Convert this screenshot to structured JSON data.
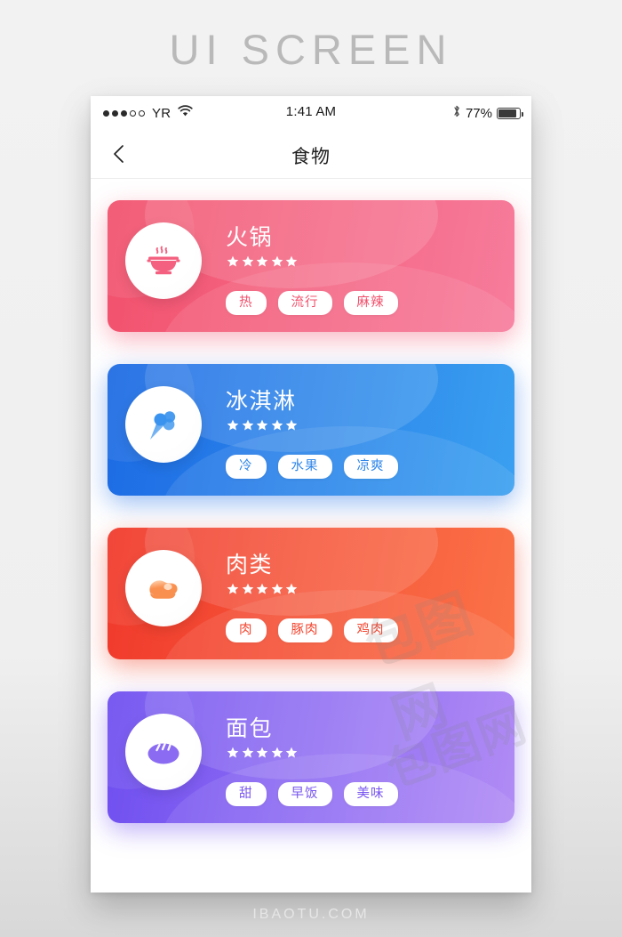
{
  "page": {
    "title": "UI SCREEN",
    "footer": "IBAOTU.COM",
    "watermark": "包图网"
  },
  "statusbar": {
    "carrier": "YR",
    "signal_filled": 3,
    "signal_empty": 2,
    "wifi_icon": "wifi-icon",
    "time": "1:41 AM",
    "bluetooth_icon": "bluetooth-icon",
    "battery_percent": "77%",
    "battery_level": 77
  },
  "navbar": {
    "back_icon": "chevron-left-icon",
    "title": "食物"
  },
  "cards": [
    {
      "id": "hotpot",
      "title": "火锅",
      "icon": "hotpot-icon",
      "rating": 5,
      "tags": [
        "热",
        "流行",
        "麻辣"
      ],
      "gradient_from": "#f2516c",
      "gradient_to": "#f77c9c",
      "accent": "#f2516c",
      "icon_color": "#f4607f",
      "tag_text_color": "#f2516c",
      "shadow_color": "rgba(242,93,120,0.45)"
    },
    {
      "id": "ice-cream",
      "title": "冰淇淋",
      "icon": "ice-cream-icon",
      "rating": 5,
      "tags": [
        "冷",
        "水果",
        "凉爽"
      ],
      "gradient_from": "#1c6ae4",
      "gradient_to": "#3ba0f0",
      "accent": "#1c6ae4",
      "icon_color": "#3a93ee",
      "tag_text_color": "#2f86ea",
      "shadow_color": "rgba(40,115,230,0.45)"
    },
    {
      "id": "meat",
      "title": "肉类",
      "icon": "meat-icon",
      "rating": 5,
      "tags": [
        "肉",
        "豚肉",
        "鸡肉"
      ],
      "gradient_from": "#f0392b",
      "gradient_to": "#fb7348",
      "accent": "#f0392b",
      "icon_color": "#fa9050",
      "tag_text_color": "#f4452f",
      "shadow_color": "rgba(240,70,45,0.45)"
    },
    {
      "id": "bread",
      "title": "面包",
      "icon": "bread-icon",
      "rating": 5,
      "tags": [
        "甜",
        "早饭",
        "美味"
      ],
      "gradient_from": "#6e4ef0",
      "gradient_to": "#b18cf5",
      "accent": "#6e4ef0",
      "icon_color": "#8a6bf2",
      "tag_text_color": "#7a57f0",
      "shadow_color": "rgba(120,85,240,0.45)"
    }
  ]
}
